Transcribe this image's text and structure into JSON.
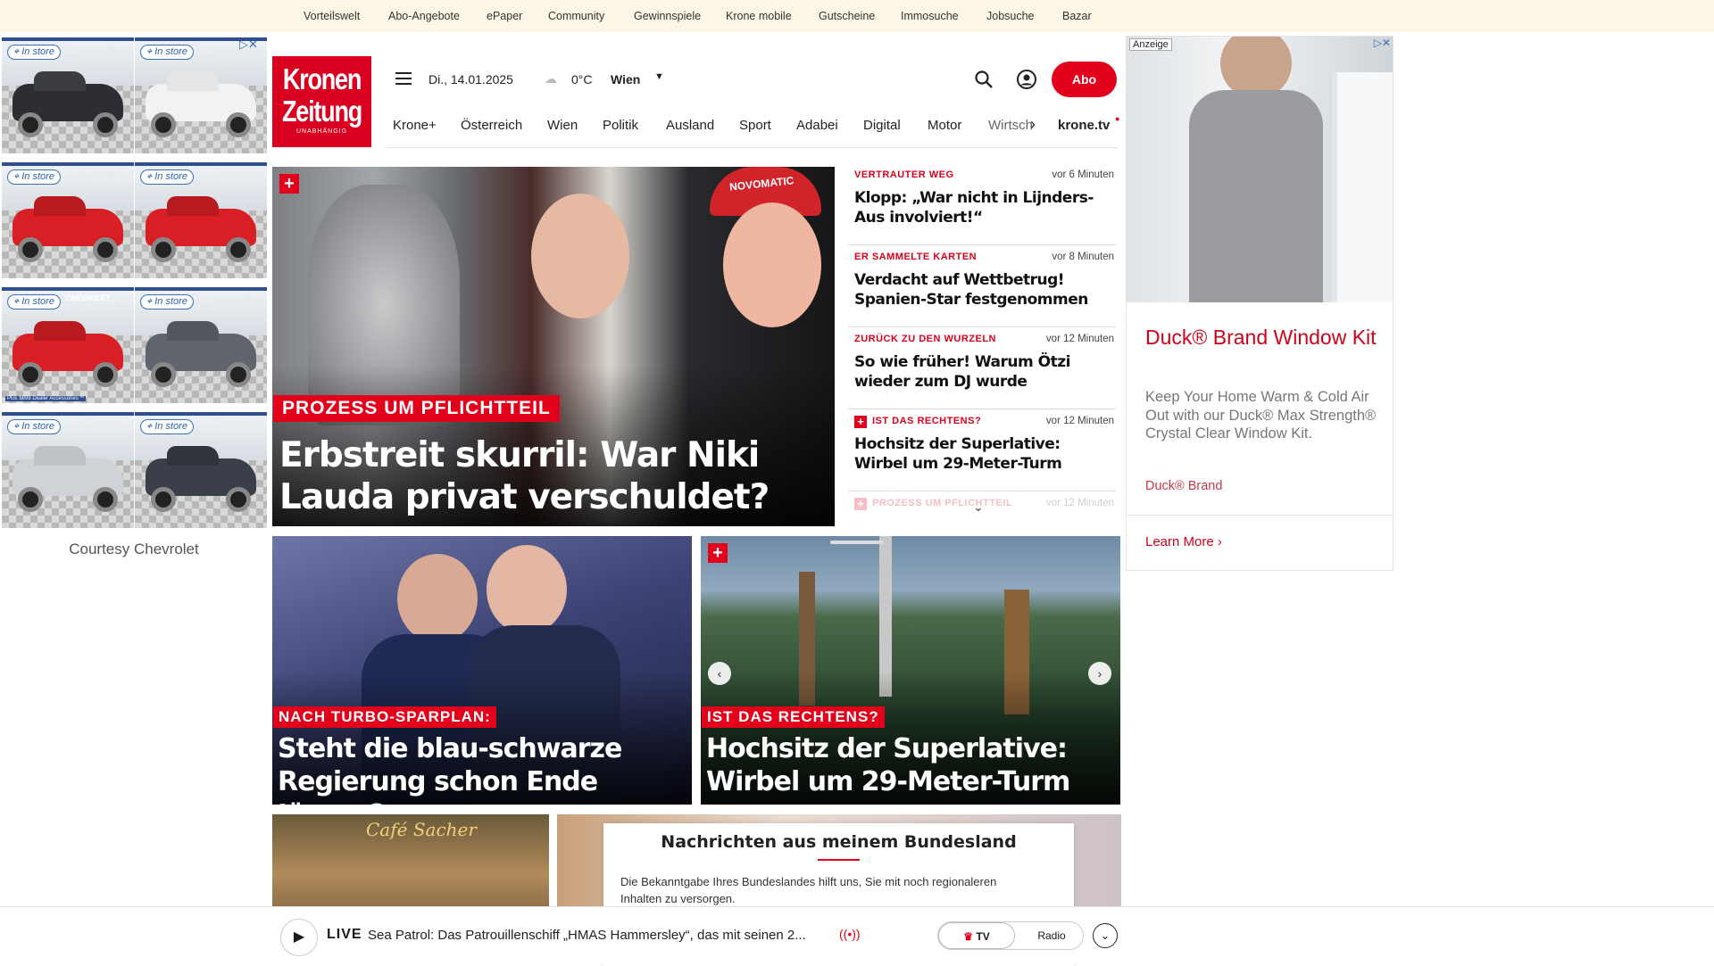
{
  "topbar": {
    "links": [
      "Vorteilswelt",
      "Abo-Angebote",
      "ePaper",
      "Community",
      "Gewinnspiele",
      "Krone mobile",
      "Gutscheine",
      "Immosuche",
      "Jobsuche",
      "Bazar"
    ]
  },
  "left_ad": {
    "pill": "In store",
    "brand_mark": "Courtesy",
    "chevrolet_mark": "CHEVROLET",
    "footer": "Courtesy Chevrolet",
    "banner_small": "Plus $898 Dealer Accessories **"
  },
  "header": {
    "logo_line1": "Kronen",
    "logo_line2": "Zeitung",
    "logo_tag": "UNABHÄNGIG",
    "date": "Di., 14.01.2025",
    "temperature": "0°C",
    "location": "Wien",
    "abo_label": "Abo"
  },
  "nav": {
    "items": [
      "Krone+",
      "Österreich",
      "Wien",
      "Politik",
      "Ausland",
      "Sport",
      "Adabei",
      "Digital",
      "Motor",
      "Wirtsch",
      "krone.tv"
    ]
  },
  "hero": {
    "kicker": "PROZESS UM PFLICHTTEIL",
    "headline": "Erbstreit skurril: War Niki Lauda privat verschuldet?",
    "cap_text": "NOVOMATIC"
  },
  "side_news": [
    {
      "kicker": "VERTRAUTER WEG",
      "time": "vor 6 Minuten",
      "title": "Klopp: „War nicht in Lijnders-Aus involviert!“"
    },
    {
      "kicker": "ER SAMMELTE KARTEN",
      "time": "vor 8 Minuten",
      "title": "Verdacht auf Wettbetrug! Spanien-Star festgenommen"
    },
    {
      "kicker": "ZURÜCK ZU DEN WURZELN",
      "time": "vor 12 Minuten",
      "title": "So wie früher! Warum Ötzi wieder zum DJ wurde"
    },
    {
      "kicker": "IST DAS RECHTENS?",
      "time": "vor 12 Minuten",
      "title": "Hochsitz der Superlative: Wirbel um 29-Meter-Turm"
    },
    {
      "kicker": "PROZESS UM PFLICHTTEIL",
      "time": "vor 12 Minuten",
      "title": ""
    }
  ],
  "cards": [
    {
      "kicker": "NACH TURBO-SPARPLAN:",
      "headline": "Steht die blau-schwarze Regierung schon Ende Jänner?"
    },
    {
      "kicker": "IST DAS RECHTENS?",
      "headline": "Hochsitz der Superlative: Wirbel um 29-Meter-Turm"
    }
  ],
  "right_ad": {
    "tag": "Anzeige",
    "title": "Duck® Brand Window Kit",
    "body": "Keep Your Home Warm & Cold Air Out with our Duck® Max Strength® Crystal Clear Window Kit.",
    "brand": "Duck® Brand",
    "cta": "Learn More"
  },
  "bundesland": {
    "title": "Nachrichten aus meinem Bundesland",
    "body": "Die Bekanntgabe Ihres Bundeslandes hilft uns, Sie mit noch regionaleren Inhalten zu versorgen."
  },
  "player": {
    "live_label": "LIVE",
    "text": "Sea Patrol: Das Patrouillenschiff „HMAS Hammersley“, das mit seinen 2...",
    "tv_label": "TV",
    "radio_label": "Radio"
  },
  "bottom_left": {
    "sign": "Café Sacher"
  },
  "colors": {
    "brand_red": "#e3001b",
    "topbar_bg": "#fbf6e6",
    "ad_title": "#d0021b"
  }
}
